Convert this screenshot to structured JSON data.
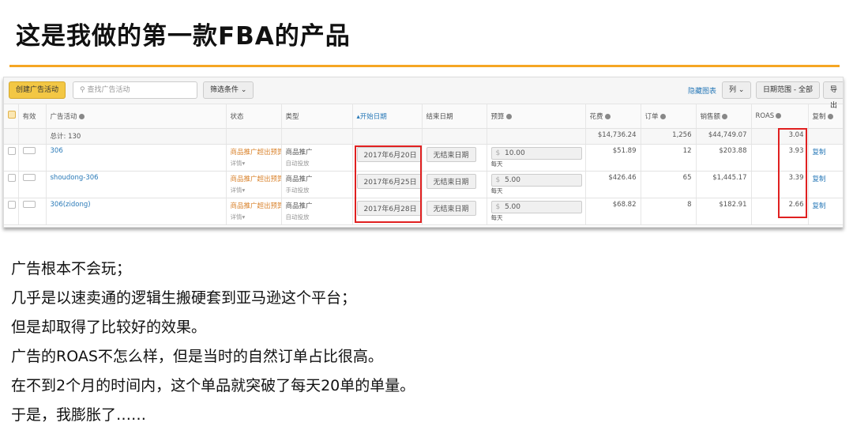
{
  "title": "这是我做的第一款FBA的产品",
  "toolbar": {
    "create": "创建广告活动",
    "search_placeholder": "查找广告活动",
    "filter": "筛选条件 ⌄",
    "hide_chart": "隐藏图表",
    "columns": "列 ⌄",
    "date_range": "日期范围 - 全部",
    "export": "导出"
  },
  "headers": {
    "active": "有效",
    "campaign": "广告活动",
    "status": "状态",
    "type": "类型",
    "start": "▴开始日期",
    "end": "结束日期",
    "budget": "预算",
    "spend": "花费",
    "orders": "订单",
    "sales": "销售额",
    "roas": "ROAS",
    "copy": "复制"
  },
  "total": {
    "label": "总计: 130",
    "spend": "$14,736.24",
    "orders": "1,256",
    "sales": "$44,749.07",
    "roas": "3.04"
  },
  "rows": [
    {
      "name": "306",
      "status": "商品推广超出预算",
      "detail": "详情▾",
      "type": "商品推广",
      "targeting": "自动投放",
      "start": "2017年6月20日",
      "end": "无结束日期",
      "currency": "$",
      "budget": "10.00",
      "per": "每天",
      "spend": "$51.89",
      "orders": "12",
      "sales": "$203.88",
      "roas": "3.93",
      "copy": "复制"
    },
    {
      "name": "shoudong-306",
      "status": "商品推广超出预算",
      "detail": "详情▾",
      "type": "商品推广",
      "targeting": "手动投放",
      "start": "2017年6月25日",
      "end": "无结束日期",
      "currency": "$",
      "budget": "5.00",
      "per": "每天",
      "spend": "$426.46",
      "orders": "65",
      "sales": "$1,445.17",
      "roas": "3.39",
      "copy": "复制"
    },
    {
      "name": "306(zidong)",
      "status": "商品推广超出预算",
      "detail": "详情▾",
      "type": "商品推广",
      "targeting": "自动投放",
      "start": "2017年6月28日",
      "end": "无结束日期",
      "currency": "$",
      "budget": "5.00",
      "per": "每天",
      "spend": "$68.82",
      "orders": "8",
      "sales": "$182.91",
      "roas": "2.66",
      "copy": "复制"
    }
  ],
  "lines": [
    "广告根本不会玩；",
    "几乎是以速卖通的逻辑生搬硬套到亚马逊这个平台；",
    "但是却取得了比较好的效果。",
    "广告的ROAS不怎么样，但是当时的自然订单占比很高。",
    "在不到2个月的时间内，这个单品就突破了每天20单的单量。",
    "于是，我膨胀了……"
  ]
}
